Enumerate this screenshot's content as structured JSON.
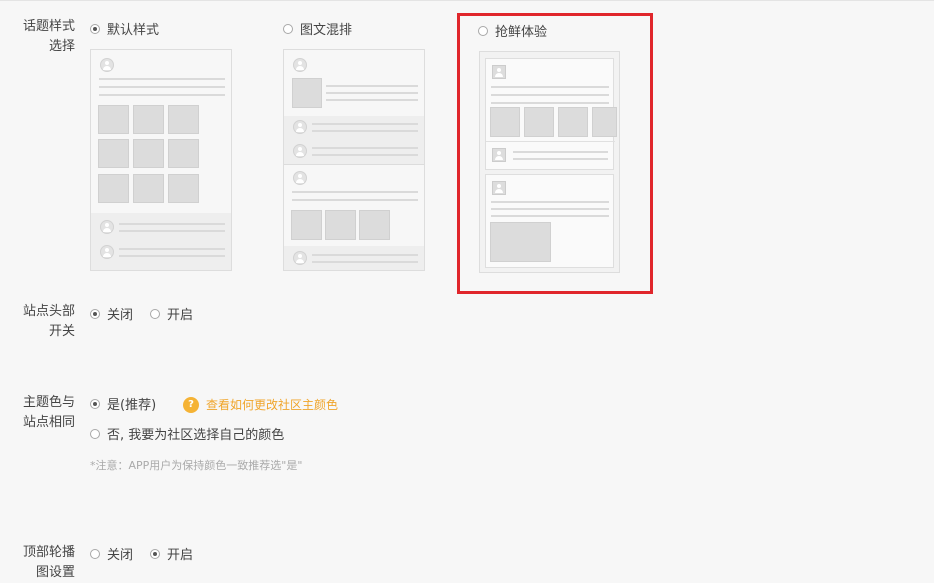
{
  "topic_style": {
    "label": "话题样式选择",
    "options": [
      {
        "label": "默认样式",
        "checked": true
      },
      {
        "label": "图文混排",
        "checked": false
      },
      {
        "label": "抢鲜体验",
        "checked": false
      }
    ]
  },
  "site_header": {
    "label": "站点头部开关",
    "options": [
      {
        "label": "关闭",
        "checked": true
      },
      {
        "label": "开启",
        "checked": false
      }
    ]
  },
  "theme_color": {
    "label": "主题色与站点相同",
    "options": [
      {
        "label": "是(推荐)",
        "checked": true
      },
      {
        "label": "否, 我要为社区选择自己的颜色",
        "checked": false
      }
    ],
    "help_link": "查看如何更改社区主颜色",
    "help_icon": "question-icon",
    "note": "*注意：APP用户为保持颜色一致推荐选\"是\""
  },
  "top_carousel": {
    "label": "顶部轮播图设置",
    "options": [
      {
        "label": "关闭",
        "checked": false
      },
      {
        "label": "开启",
        "checked": true
      }
    ]
  },
  "colors": {
    "highlight": "#e0262b",
    "link": "#f0a52b"
  }
}
